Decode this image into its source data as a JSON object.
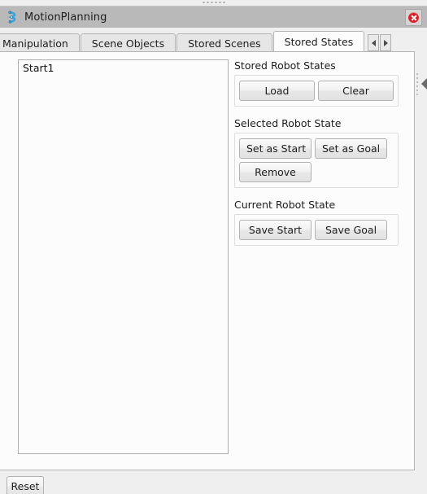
{
  "window": {
    "title": "MotionPlanning",
    "icon": "motion-planning-icon",
    "close_label": "✕"
  },
  "tabs": {
    "items": [
      {
        "label": "Manipulation",
        "active": false
      },
      {
        "label": "Scene Objects",
        "active": false
      },
      {
        "label": "Stored Scenes",
        "active": false
      },
      {
        "label": "Stored States",
        "active": true
      }
    ],
    "nav_prev": "◀",
    "nav_next": "▶"
  },
  "states_list": {
    "items": [
      "Start1"
    ]
  },
  "groups": [
    {
      "title": "Stored Robot States",
      "rows": [
        [
          {
            "label": "Load",
            "width": "w95"
          },
          {
            "label": "Clear",
            "width": "w95"
          }
        ]
      ]
    },
    {
      "title": "Selected Robot State",
      "rows": [
        [
          {
            "label": "Set as Start",
            "width": "w88"
          },
          {
            "label": "Set as Goal",
            "width": "w88"
          }
        ],
        [
          {
            "label": "Remove",
            "width": "w88"
          }
        ]
      ]
    },
    {
      "title": "Current Robot State",
      "rows": [
        [
          {
            "label": "Save Start",
            "width": "w88"
          },
          {
            "label": "Save Goal",
            "width": "w88"
          }
        ]
      ]
    }
  ],
  "footer": {
    "reset_label": "Reset"
  },
  "colors": {
    "titlebar": "#b9b9b9",
    "panel": "#fcfcfc",
    "background": "#efefef",
    "close_red": "#d8202a",
    "icon_blue": "#3aa3dc",
    "border": "#b4b4b4"
  }
}
